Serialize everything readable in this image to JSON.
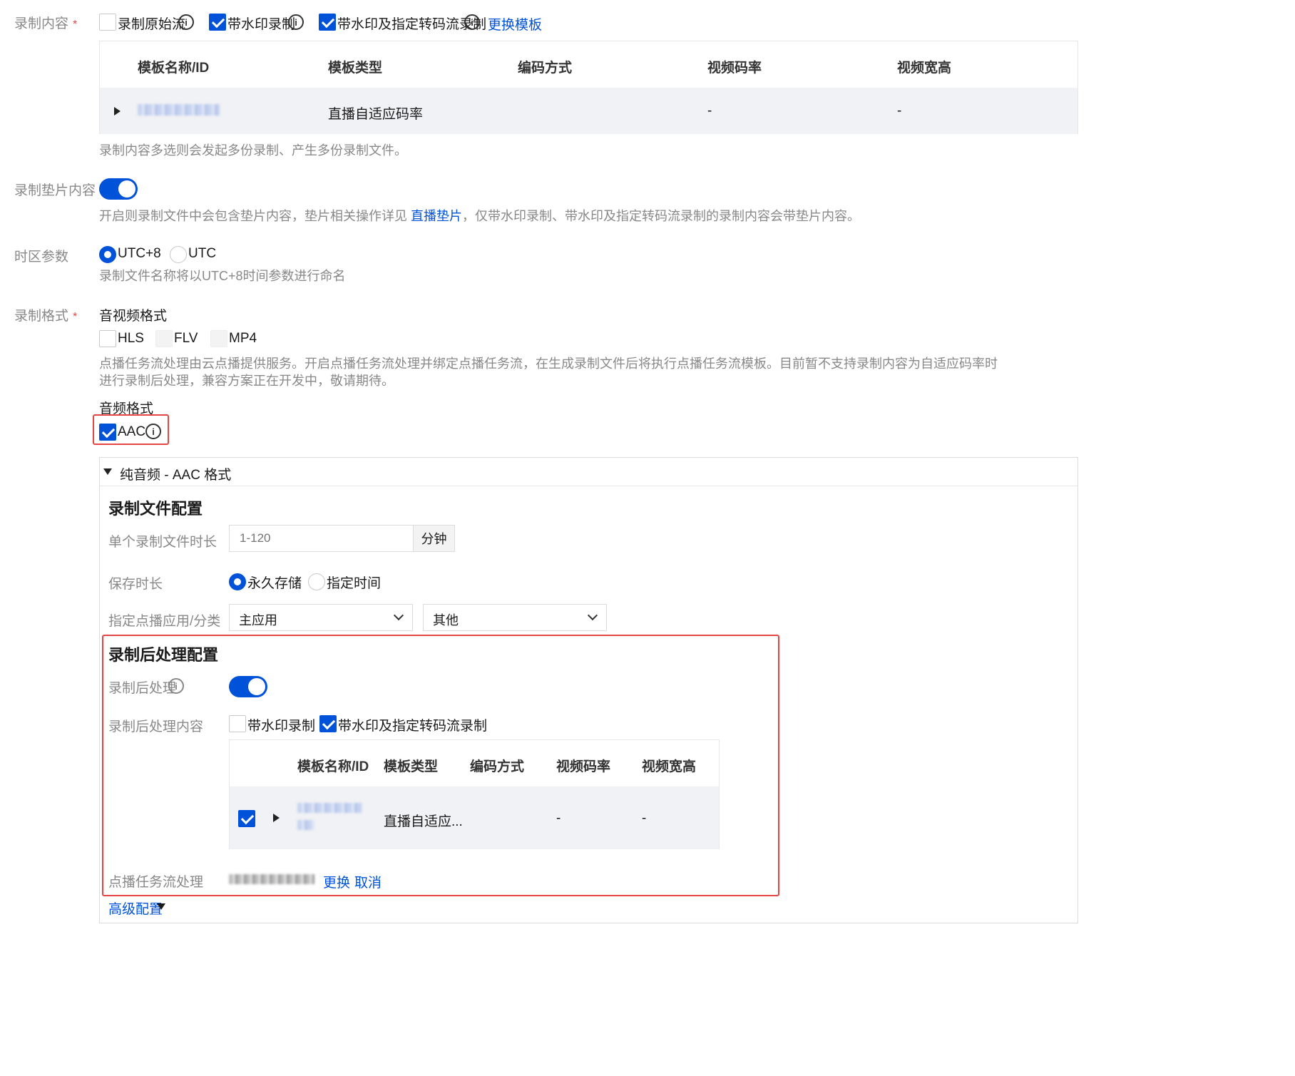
{
  "record_content": {
    "label": "录制内容",
    "required": "*",
    "options": [
      {
        "label": "录制原始流",
        "checked": false
      },
      {
        "label": "带水印录制",
        "checked": true
      },
      {
        "label": "带水印及指定转码流录制",
        "checked": true
      }
    ],
    "change_template": "更换模板",
    "table": {
      "headers": [
        "模板名称/ID",
        "模板类型",
        "编码方式",
        "视频码率",
        "视频宽高"
      ],
      "row": {
        "type": "直播自适应码率",
        "bitrate": "-",
        "size": "-"
      }
    },
    "hint": "录制内容多选则会发起多份录制、产生多份录制文件。"
  },
  "slate": {
    "label": "录制垫片内容",
    "enabled": true,
    "hint_before": "开启则录制文件中会包含垫片内容，垫片相关操作详见",
    "hint_link": "直播垫片",
    "hint_after": "，仅带水印录制、带水印及指定转码流录制的录制内容会带垫片内容。"
  },
  "timezone": {
    "label": "时区参数",
    "options": [
      "UTC+8",
      "UTC"
    ],
    "selected": "UTC+8",
    "hint": "录制文件名称将以UTC+8时间参数进行命名"
  },
  "format": {
    "label": "录制格式",
    "required": "*",
    "av_title": "音视频格式",
    "av_options": [
      "HLS",
      "FLV",
      "MP4"
    ],
    "av_hint_1": "点播任务流处理由云点播提供服务。开启点播任务流处理并绑定点播任务流，在生成录制文件后将执行点播任务流模板。目前暂不支持录制内容为自适应码率时",
    "av_hint_2": "进行录制后处理，兼容方案正在开发中，敬请期待。",
    "audio_title": "音频格式",
    "audio_option": "AAC",
    "audio_checked": true
  },
  "panel": {
    "title": "纯音频 - AAC 格式",
    "file_config": {
      "title": "录制文件配置",
      "duration_label": "单个录制文件时长",
      "duration_placeholder": "1-120",
      "duration_unit": "分钟",
      "retention_label": "保存时长",
      "retention_options": [
        "永久存储",
        "指定时间"
      ],
      "retention_selected": "永久存储",
      "vod_label": "指定点播应用/分类",
      "vod_app": "主应用",
      "vod_category": "其他"
    },
    "post": {
      "title": "录制后处理配置",
      "enable_label": "录制后处理",
      "enabled": true,
      "content_label": "录制后处理内容",
      "content_options": [
        {
          "label": "带水印录制",
          "checked": false
        },
        {
          "label": "带水印及指定转码流录制",
          "checked": true
        }
      ],
      "table": {
        "headers": [
          "模板名称/ID",
          "模板类型",
          "编码方式",
          "视频码率",
          "视频宽高"
        ],
        "row": {
          "checked": true,
          "type": "直播自适应...",
          "bitrate": "-",
          "size": "-"
        }
      },
      "vod_task_label": "点播任务流处理",
      "vod_task_change": "更换",
      "vod_task_cancel": "取消"
    },
    "advanced": "高级配置"
  },
  "colors": {
    "primary": "#0052d9",
    "highlight": "#e54545"
  }
}
